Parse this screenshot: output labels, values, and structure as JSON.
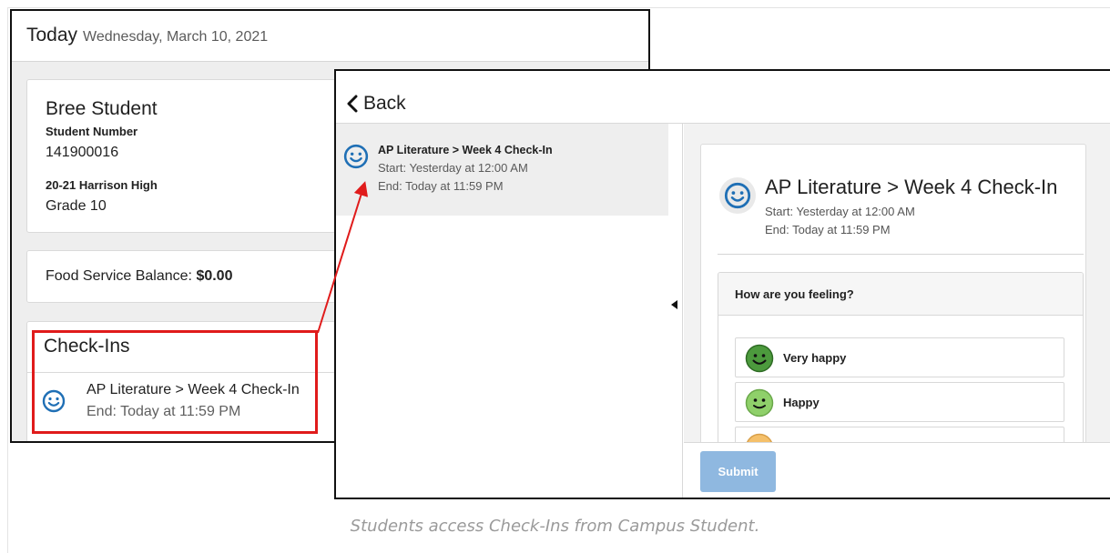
{
  "today": {
    "title": "Today",
    "date": "Wednesday, March 10, 2021"
  },
  "student": {
    "name": "Bree Student",
    "number_label": "Student Number",
    "number_value": "141900016",
    "school_label": "20-21 Harrison High",
    "grade": "Grade 10"
  },
  "food_service": {
    "label": "Food Service Balance:",
    "amount": "$0.00"
  },
  "checkins_card": {
    "title": "Check-Ins",
    "item_title": "AP Literature > Week 4 Check-In",
    "item_end": "End: Today at 11:59 PM"
  },
  "detail_window": {
    "back_label": "Back",
    "list_item": {
      "title": "AP Literature > Week 4 Check-In",
      "start": "Start: Yesterday at 12:00 AM",
      "end": "End: Today at 11:59 PM"
    },
    "detail": {
      "title": "AP Literature > Week 4 Check-In",
      "start": "Start: Yesterday at 12:00 AM",
      "end": "End: Today at 11:59 PM"
    },
    "question": "How are you feeling?",
    "options": [
      {
        "label": "Very happy",
        "icon": "very-happy-face-icon",
        "color": "#4c9a3d"
      },
      {
        "label": "Happy",
        "icon": "happy-face-icon",
        "color": "#8fd06a"
      },
      {
        "label": "",
        "icon": "neutral-face-icon",
        "color": "#f5c06a"
      }
    ],
    "submit_label": "Submit"
  },
  "caption": "Students access Check-Ins from Campus Student.",
  "colors": {
    "accent_blue": "#1f6fb5",
    "highlight_red": "#e01b1b",
    "submit_disabled": "#8fb8e0"
  }
}
